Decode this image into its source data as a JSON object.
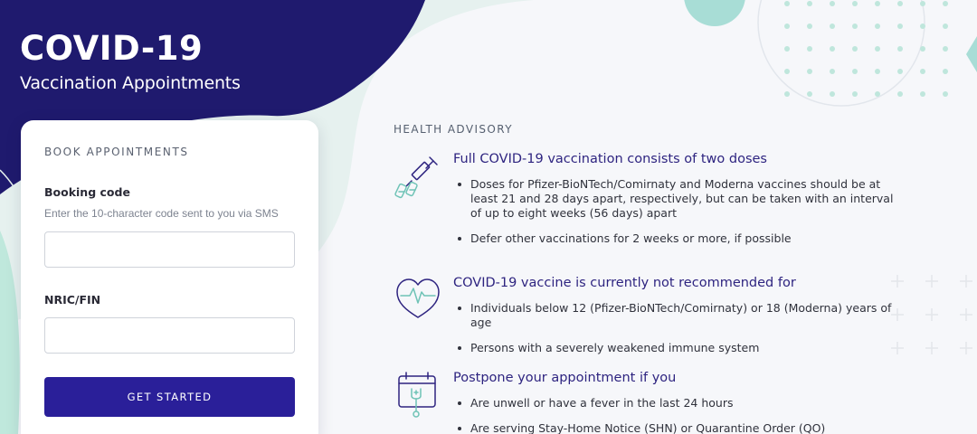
{
  "header": {
    "title": "COVID-19",
    "subtitle": "Vaccination Appointments"
  },
  "booking": {
    "title": "BOOK APPOINTMENTS",
    "booking_code_label": "Booking code",
    "booking_code_hint": "Enter the 10-character code sent to you via SMS",
    "booking_code_value": "",
    "nric_label": "NRIC/FIN",
    "nric_value": "",
    "button_label": "GET STARTED"
  },
  "advisory": {
    "title": "HEALTH ADVISORY",
    "sections": [
      {
        "icon": "vaccine-vials-icon",
        "heading": "Full COVID-19 vaccination consists of two doses",
        "items": [
          "Doses for Pfizer-BioNTech/Comirnaty and Moderna vaccines should be at least 21 and 28 days apart, respectively, but can be taken with an interval of up to eight weeks (56 days) apart",
          "Defer other vaccinations for 2 weeks or more, if possible"
        ]
      },
      {
        "icon": "heart-heartbeat-icon",
        "heading": "COVID-19 vaccine is currently not recommended for",
        "items": [
          "Individuals below 12 (Pfizer-BioNTech/Comirnaty) or 18 (Moderna) years of age",
          "Persons with a severely weakened immune system"
        ]
      },
      {
        "icon": "calendar-stethoscope-icon",
        "heading": "Postpone your appointment if you",
        "items": [
          "Are unwell or have a fever in the last 24 hours",
          "Are serving Stay-Home Notice (SHN) or Quarantine Order (QO)"
        ]
      }
    ]
  },
  "colors": {
    "navy": "#1f1a6e",
    "primary_button": "#2a1f99",
    "mint": "#bfe8dc",
    "teal_accent": "#9fdcd3",
    "heading_purple": "#2e2480",
    "icon_teal": "#6fc3b6"
  }
}
